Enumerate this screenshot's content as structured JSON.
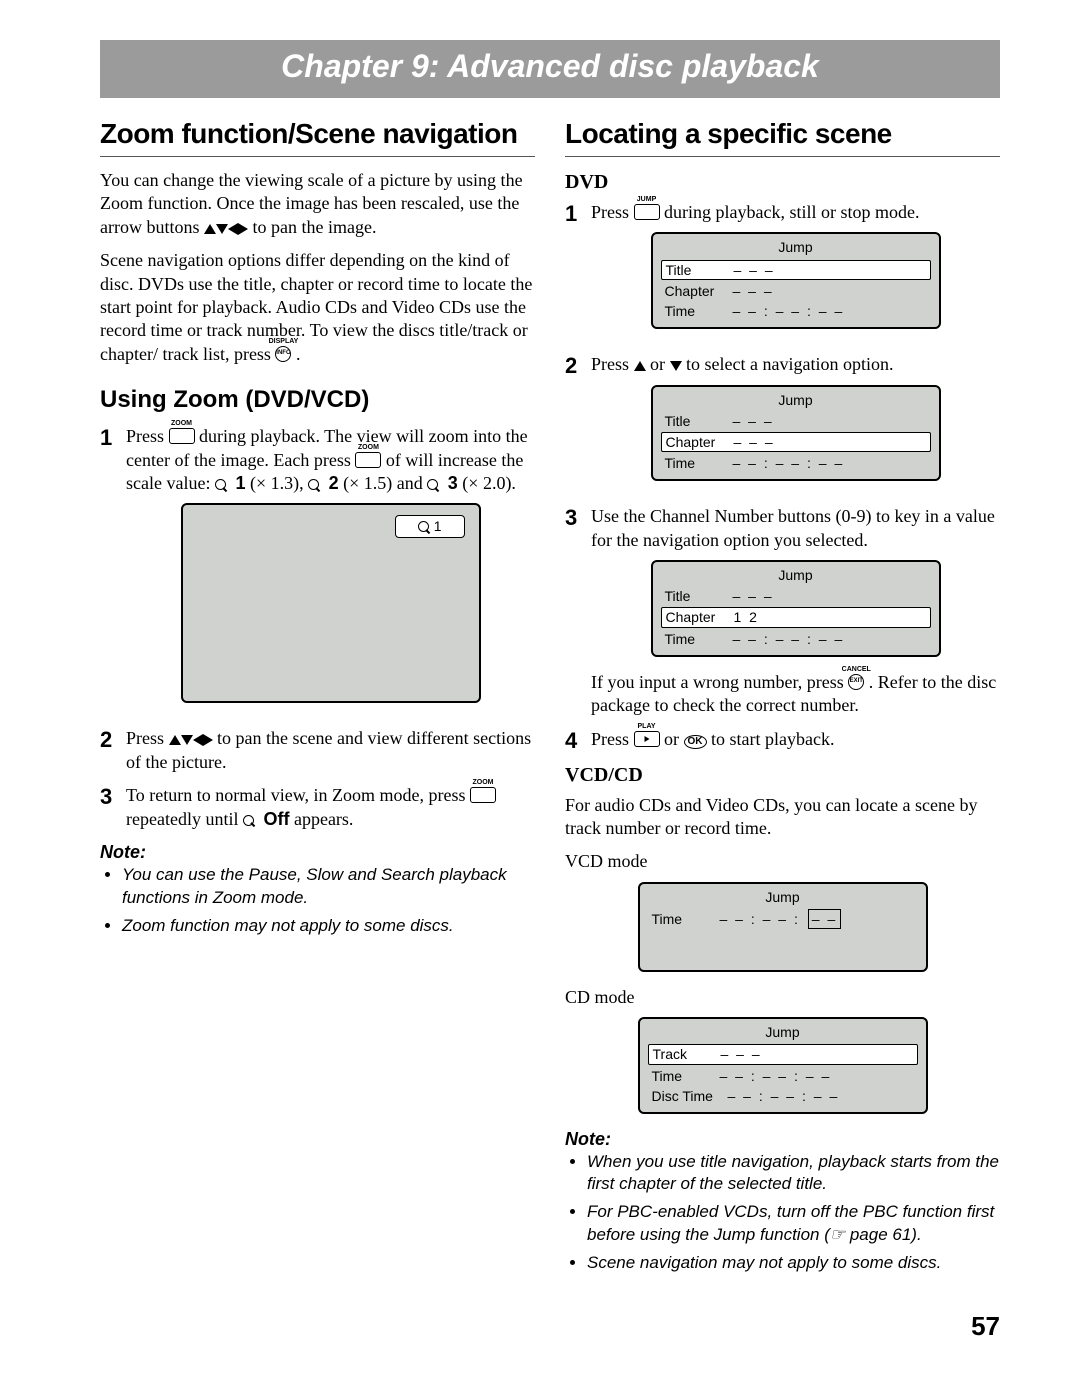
{
  "chapter_banner": "Chapter 9: Advanced disc playback",
  "page_number": "57",
  "left": {
    "h2": "Zoom function/Scene navigation",
    "intro1_a": "You can change the viewing scale of a picture by using the Zoom function. Once the image has been rescaled, use the arrow buttons ",
    "intro1_b": " to pan the image.",
    "intro2_a": "Scene navigation options differ depending on the kind of disc. DVDs use the title, chapter or record time to locate the start point for playback. Audio CDs and Video CDs use the record time or track number. To view the discs title/track or chapter/ track list, press ",
    "intro2_b": " .",
    "display_label": "DISPLAY",
    "info_label": "INFO",
    "h3": "Using Zoom (DVD/VCD)",
    "step1_a": "Press ",
    "step1_b": " during playback. The view will zoom into the center of the image. Each press ",
    "step1_c": " of will increase the scale value: ",
    "scale1": "1",
    "scale1_mult": " (× 1.3), ",
    "scale2": "2",
    "scale2_mult": " (× 1.5) and ",
    "scale3": "3",
    "scale3_mult": " (× 2.0).",
    "zoom_label": "ZOOM",
    "osd_zoom_indicator": "1",
    "step2_a": "Press ",
    "step2_b": " to pan the scene and view different sections of the picture.",
    "step3_a": "To return to normal view, in Zoom mode, press ",
    "step3_b": " repeatedly until ",
    "off_label": "Off",
    "step3_c": " appears.",
    "note_head": "Note:",
    "note1": "You can use the Pause, Slow and Search playback functions in Zoom mode.",
    "note2": "Zoom function may not apply to some discs."
  },
  "right": {
    "h2": "Locating a specific scene",
    "dvd_head": "DVD",
    "jump_label": "JUMP",
    "step1_a": "Press ",
    "step1_b": " during playback, still or stop mode.",
    "osd_jump_title": "Jump",
    "rows": {
      "title": "Title",
      "chapter": "Chapter",
      "time": "Time",
      "track": "Track",
      "disc_time": "Disc Time"
    },
    "dash3": "– – –",
    "timeval": "– –   :   – –   :   – –",
    "step2_a": "Press ",
    "step2_b": " or ",
    "step2_c": " to select a navigation option.",
    "step3": "Use the Channel Number buttons (0-9) to key in a value for the navigation option you selected.",
    "chapter_val": "1 2",
    "wrong_a": "If you input a wrong number, press ",
    "wrong_b": " . Refer to the disc package to check the correct number.",
    "cancel_label": "CANCEL",
    "exit_label": "EXIT",
    "step4_a": "Press ",
    "step4_b": " or ",
    "step4_c": " to start playback.",
    "play_label": "PLAY",
    "ok_label": "OK",
    "vcdcd_head": "VCD/CD",
    "vcdcd_intro": "For audio CDs and Video CDs, you can locate a scene by track number or record time.",
    "vcd_mode": "VCD mode",
    "cd_mode": "CD mode",
    "vcd_time_prefix": "– –   :   – –   :",
    "vcd_time_box": "– –",
    "note_head": "Note:",
    "rnote1": "When you use title navigation, playback starts from the first chapter of the selected title.",
    "rnote2": "For PBC-enabled VCDs, turn off the PBC function first before using the Jump function (☞ page 61).",
    "rnote3": "Scene navigation may not apply to some discs."
  }
}
